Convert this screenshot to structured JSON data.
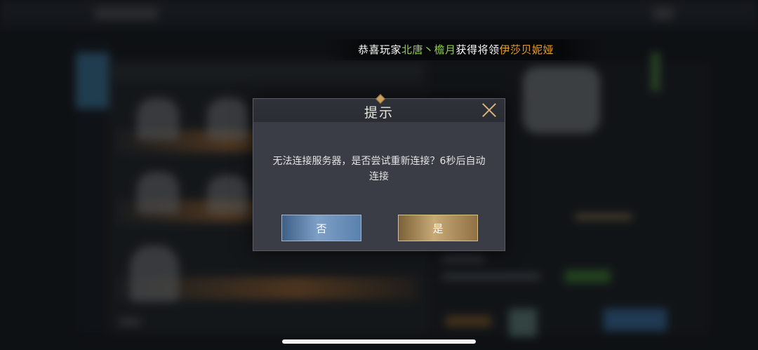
{
  "announcement": {
    "prefix": "恭喜玩家",
    "player": "北唐丶檐月",
    "middle": "获得将领",
    "reward": "伊莎贝妮娅"
  },
  "dialog": {
    "title": "提示",
    "message": "无法连接服务器，是否尝试重新连接？6秒后自动连接",
    "no_label": "否",
    "yes_label": "是"
  },
  "colors": {
    "highlight_player": "#8fd14f",
    "highlight_reward": "#e8a235",
    "button_no": "#6f92bb",
    "button_yes": "#b89862"
  },
  "icons": {
    "close": "close-icon"
  }
}
